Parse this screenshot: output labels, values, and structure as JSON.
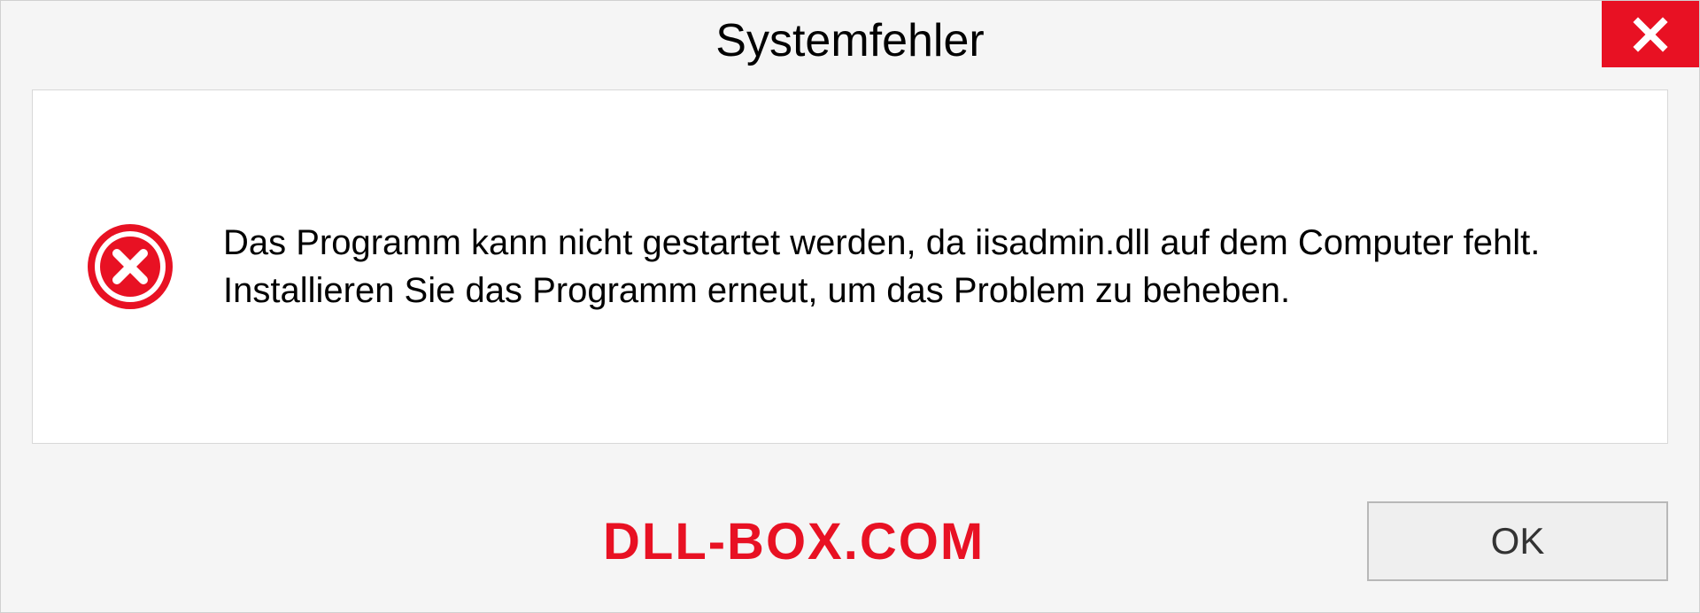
{
  "dialog": {
    "title": "Systemfehler",
    "message": "Das Programm kann nicht gestartet werden, da iisadmin.dll auf dem Computer fehlt. Installieren Sie das Programm erneut, um das Problem zu beheben.",
    "ok_label": "OK"
  },
  "watermark": "DLL-BOX.COM",
  "colors": {
    "close_bg": "#e81123",
    "error_icon": "#e81123"
  }
}
